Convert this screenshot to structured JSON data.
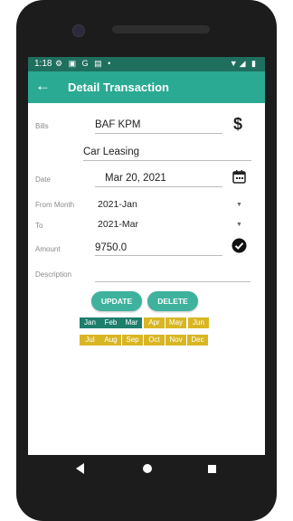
{
  "status": {
    "time": "1:18",
    "left_icons": "⚙ ▣ G ▤ •",
    "right_icons": "▼◢ ▮"
  },
  "header": {
    "back_icon": "arrow-back-icon",
    "title": "Detail Transaction"
  },
  "form": {
    "bills_label": "Bills",
    "bills_value": "BAF KPM",
    "bills_subvalue": "Car Leasing",
    "date_label": "Date",
    "date_value": "Mar 20, 2021",
    "from_month_label": "From Month",
    "from_month_value": "2021-Jan",
    "to_label": "To",
    "to_value": "2021-Mar",
    "amount_label": "Amount",
    "amount_value": "9750.0",
    "description_label": "Description",
    "description_value": ""
  },
  "buttons": {
    "update": "UPDATE",
    "delete": "DELETE"
  },
  "months_row1": [
    "Jan",
    "Feb",
    "Mar",
    "Apr",
    "May",
    "Jun"
  ],
  "months_row2": [
    "Jul",
    "Aug",
    "Sep",
    "Oct",
    "Nov",
    "Dec"
  ],
  "colors": {
    "accent": "#2aaa92",
    "paid_month": "#1e7e6c",
    "unpaid_month": "#d8b623",
    "button": "#3fb29e"
  }
}
